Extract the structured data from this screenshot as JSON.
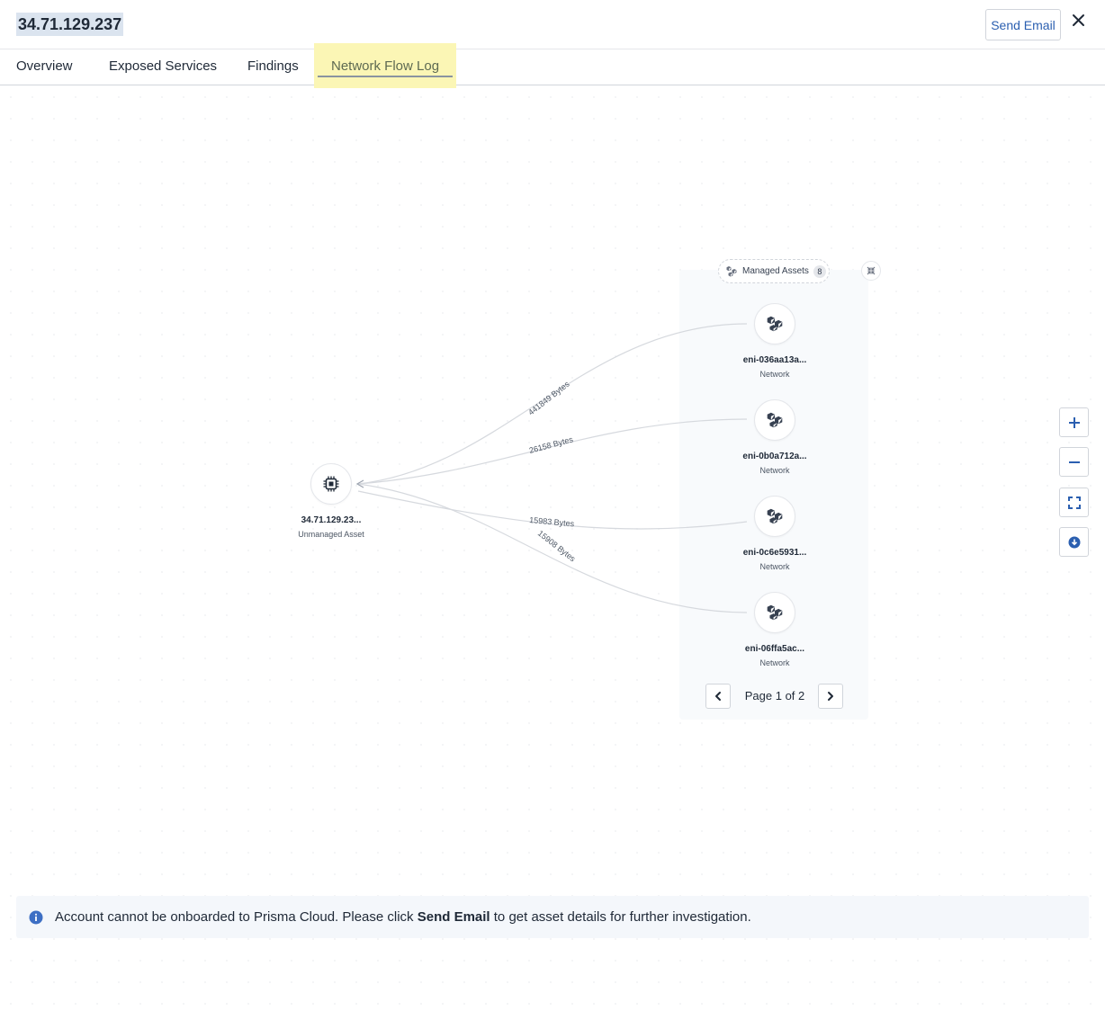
{
  "header": {
    "title": "34.71.129.237",
    "send_email_label": "Send Email"
  },
  "tabs": [
    {
      "label": "Overview"
    },
    {
      "label": "Exposed Services"
    },
    {
      "label": "Findings"
    },
    {
      "label": "Network Flow Log",
      "active": true
    }
  ],
  "graph": {
    "source": {
      "name": "34.71.129.23...",
      "type": "Unmanaged Asset"
    },
    "group": {
      "label": "Managed Assets",
      "count": "8"
    },
    "targets": [
      {
        "name": "eni-036aa13a...",
        "type": "Network"
      },
      {
        "name": "eni-0b0a712a...",
        "type": "Network"
      },
      {
        "name": "eni-0c6e5931...",
        "type": "Network"
      },
      {
        "name": "eni-06ffa5ac...",
        "type": "Network"
      }
    ],
    "edges": [
      {
        "label": "441849 Bytes"
      },
      {
        "label": "26158 Bytes"
      },
      {
        "label": "15983 Bytes"
      },
      {
        "label": "15908 Bytes"
      }
    ],
    "pager": {
      "text": "Page 1 of 2"
    }
  },
  "banner": {
    "text_before": "Account cannot be onboarded to Prisma Cloud. Please click ",
    "link": "Send Email",
    "text_after": " to get asset details for further investigation."
  },
  "colors": {
    "accent": "#2b5fb0",
    "active_tab_bg": "#fbf6b5",
    "banner_bg": "#f4f7fb",
    "info_icon": "#3d6fc4"
  }
}
